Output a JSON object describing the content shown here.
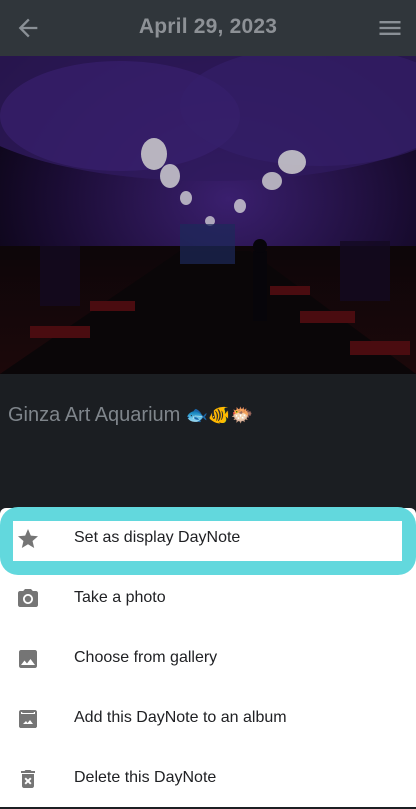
{
  "header": {
    "title": "April 29, 2023",
    "back_icon": "arrow-left-icon",
    "menu_icon": "hamburger-menu-icon"
  },
  "photo": {
    "description_icon": "photo-image"
  },
  "note": {
    "text": "Ginza Art Aquarium",
    "emoji": "🐟🐠🐡"
  },
  "menu": {
    "items": [
      {
        "label": "Set as display DayNote",
        "icon": "star-icon"
      },
      {
        "label": "Take a photo",
        "icon": "camera-icon"
      },
      {
        "label": "Choose from gallery",
        "icon": "image-icon"
      },
      {
        "label": "Add this DayNote to an album",
        "icon": "photo-album-icon"
      },
      {
        "label": "Delete this DayNote",
        "icon": "trash-icon"
      }
    ]
  },
  "colors": {
    "appbar": "#30363b",
    "highlight": "#62d8dd",
    "sheet": "#ffffff"
  }
}
